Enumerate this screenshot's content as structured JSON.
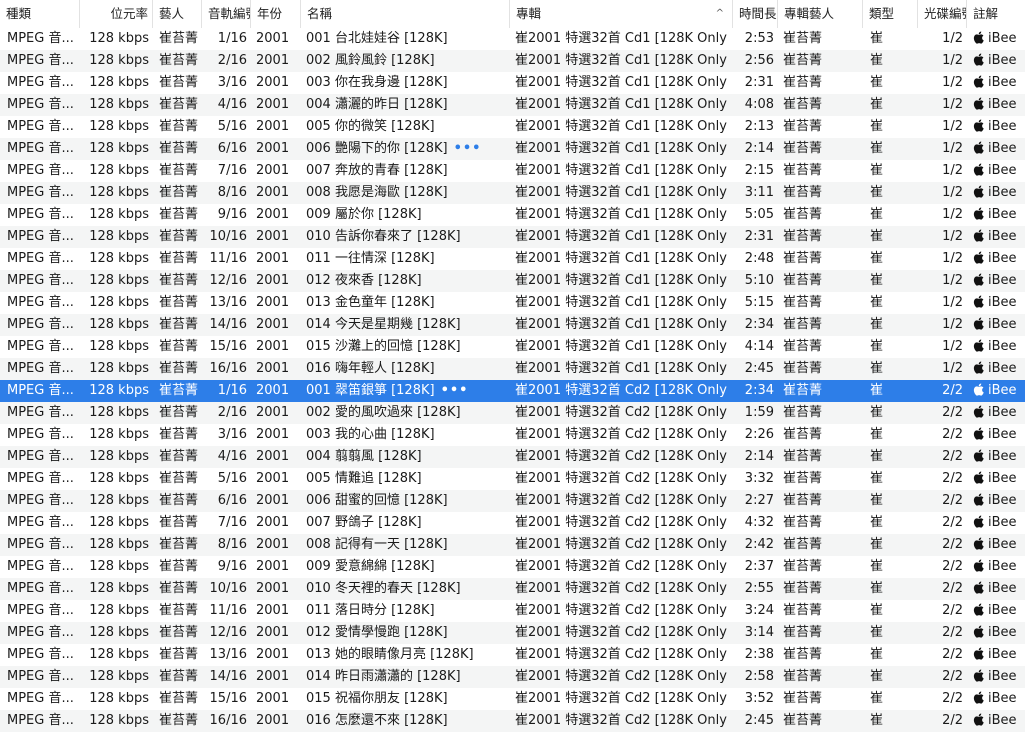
{
  "columns": {
    "kind": "種類",
    "bitrate": "位元率",
    "artist": "藝人",
    "track": "音軌編號",
    "year": "年份",
    "name": "名稱",
    "album": "專輯",
    "sort_indicator": "^",
    "time": "時間長度",
    "album_artist": "專輯藝人",
    "genre": "類型",
    "disc": "光碟編號",
    "comment": "註解"
  },
  "selected_row_index": 16,
  "rows": [
    {
      "kind": "MPEG 音...",
      "bitrate": "128 kbps",
      "artist": "崔苔菁",
      "track": "1/16",
      "year": "2001",
      "name": "001 台北娃娃谷 [128K]",
      "album": "崔2001 特選32首 Cd1 [128K Only]",
      "time": "2:53",
      "album_artist": "崔苔菁",
      "genre": "崔",
      "disc": "1/2",
      "comment": "iBee"
    },
    {
      "kind": "MPEG 音...",
      "bitrate": "128 kbps",
      "artist": "崔苔菁",
      "track": "2/16",
      "year": "2001",
      "name": "002 風鈴風鈴 [128K]",
      "album": "崔2001 特選32首 Cd1 [128K Only]",
      "time": "2:56",
      "album_artist": "崔苔菁",
      "genre": "崔",
      "disc": "1/2",
      "comment": "iBee"
    },
    {
      "kind": "MPEG 音...",
      "bitrate": "128 kbps",
      "artist": "崔苔菁",
      "track": "3/16",
      "year": "2001",
      "name": "003 你在我身邊 [128K]",
      "album": "崔2001 特選32首 Cd1 [128K Only]",
      "time": "2:31",
      "album_artist": "崔苔菁",
      "genre": "崔",
      "disc": "1/2",
      "comment": "iBee"
    },
    {
      "kind": "MPEG 音...",
      "bitrate": "128 kbps",
      "artist": "崔苔菁",
      "track": "4/16",
      "year": "2001",
      "name": "004 瀟灑的昨日 [128K]",
      "album": "崔2001 特選32首 Cd1 [128K Only]",
      "time": "4:08",
      "album_artist": "崔苔菁",
      "genre": "崔",
      "disc": "1/2",
      "comment": "iBee"
    },
    {
      "kind": "MPEG 音...",
      "bitrate": "128 kbps",
      "artist": "崔苔菁",
      "track": "5/16",
      "year": "2001",
      "name": "005 你的微笑 [128K]",
      "album": "崔2001 特選32首 Cd1 [128K Only]",
      "time": "2:13",
      "album_artist": "崔苔菁",
      "genre": "崔",
      "disc": "1/2",
      "comment": "iBee"
    },
    {
      "kind": "MPEG 音...",
      "bitrate": "128 kbps",
      "artist": "崔苔菁",
      "track": "6/16",
      "year": "2001",
      "name": "006 艷陽下的你 [128K]",
      "album": "崔2001 特選32首 Cd1 [128K Only]",
      "time": "2:14",
      "album_artist": "崔苔菁",
      "genre": "崔",
      "disc": "1/2",
      "comment": "iBee",
      "more": true
    },
    {
      "kind": "MPEG 音...",
      "bitrate": "128 kbps",
      "artist": "崔苔菁",
      "track": "7/16",
      "year": "2001",
      "name": "007 奔放的青春 [128K]",
      "album": "崔2001 特選32首 Cd1 [128K Only]",
      "time": "2:15",
      "album_artist": "崔苔菁",
      "genre": "崔",
      "disc": "1/2",
      "comment": "iBee"
    },
    {
      "kind": "MPEG 音...",
      "bitrate": "128 kbps",
      "artist": "崔苔菁",
      "track": "8/16",
      "year": "2001",
      "name": "008 我愿是海歐 [128K]",
      "album": "崔2001 特選32首 Cd1 [128K Only]",
      "time": "3:11",
      "album_artist": "崔苔菁",
      "genre": "崔",
      "disc": "1/2",
      "comment": "iBee"
    },
    {
      "kind": "MPEG 音...",
      "bitrate": "128 kbps",
      "artist": "崔苔菁",
      "track": "9/16",
      "year": "2001",
      "name": "009 屬於你 [128K]",
      "album": "崔2001 特選32首 Cd1 [128K Only]",
      "time": "5:05",
      "album_artist": "崔苔菁",
      "genre": "崔",
      "disc": "1/2",
      "comment": "iBee"
    },
    {
      "kind": "MPEG 音...",
      "bitrate": "128 kbps",
      "artist": "崔苔菁",
      "track": "10/16",
      "year": "2001",
      "name": "010 告訴你春來了 [128K]",
      "album": "崔2001 特選32首 Cd1 [128K Only]",
      "time": "2:31",
      "album_artist": "崔苔菁",
      "genre": "崔",
      "disc": "1/2",
      "comment": "iBee"
    },
    {
      "kind": "MPEG 音...",
      "bitrate": "128 kbps",
      "artist": "崔苔菁",
      "track": "11/16",
      "year": "2001",
      "name": "011 一往情深 [128K]",
      "album": "崔2001 特選32首 Cd1 [128K Only]",
      "time": "2:48",
      "album_artist": "崔苔菁",
      "genre": "崔",
      "disc": "1/2",
      "comment": "iBee"
    },
    {
      "kind": "MPEG 音...",
      "bitrate": "128 kbps",
      "artist": "崔苔菁",
      "track": "12/16",
      "year": "2001",
      "name": "012 夜來香 [128K]",
      "album": "崔2001 特選32首 Cd1 [128K Only]",
      "time": "5:10",
      "album_artist": "崔苔菁",
      "genre": "崔",
      "disc": "1/2",
      "comment": "iBee"
    },
    {
      "kind": "MPEG 音...",
      "bitrate": "128 kbps",
      "artist": "崔苔菁",
      "track": "13/16",
      "year": "2001",
      "name": "013 金色童年 [128K]",
      "album": "崔2001 特選32首 Cd1 [128K Only]",
      "time": "5:15",
      "album_artist": "崔苔菁",
      "genre": "崔",
      "disc": "1/2",
      "comment": "iBee"
    },
    {
      "kind": "MPEG 音...",
      "bitrate": "128 kbps",
      "artist": "崔苔菁",
      "track": "14/16",
      "year": "2001",
      "name": "014 今天是星期幾 [128K]",
      "album": "崔2001 特選32首 Cd1 [128K Only]",
      "time": "2:34",
      "album_artist": "崔苔菁",
      "genre": "崔",
      "disc": "1/2",
      "comment": "iBee"
    },
    {
      "kind": "MPEG 音...",
      "bitrate": "128 kbps",
      "artist": "崔苔菁",
      "track": "15/16",
      "year": "2001",
      "name": "015 沙灘上的回憶 [128K]",
      "album": "崔2001 特選32首 Cd1 [128K Only]",
      "time": "4:14",
      "album_artist": "崔苔菁",
      "genre": "崔",
      "disc": "1/2",
      "comment": "iBee"
    },
    {
      "kind": "MPEG 音...",
      "bitrate": "128 kbps",
      "artist": "崔苔菁",
      "track": "16/16",
      "year": "2001",
      "name": "016 嗨年輕人 [128K]",
      "album": "崔2001 特選32首 Cd1 [128K Only]",
      "time": "2:45",
      "album_artist": "崔苔菁",
      "genre": "崔",
      "disc": "1/2",
      "comment": "iBee"
    },
    {
      "kind": "MPEG 音...",
      "bitrate": "128 kbps",
      "artist": "崔苔菁",
      "track": "1/16",
      "year": "2001",
      "name": "001 翠笛銀箏 [128K]",
      "album": "崔2001 特選32首 Cd2 [128K Only]",
      "time": "2:34",
      "album_artist": "崔苔菁",
      "genre": "崔",
      "disc": "2/2",
      "comment": "iBee",
      "more": true
    },
    {
      "kind": "MPEG 音...",
      "bitrate": "128 kbps",
      "artist": "崔苔菁",
      "track": "2/16",
      "year": "2001",
      "name": "002 愛的風吹過來 [128K]",
      "album": "崔2001 特選32首 Cd2 [128K Only]",
      "time": "1:59",
      "album_artist": "崔苔菁",
      "genre": "崔",
      "disc": "2/2",
      "comment": "iBee"
    },
    {
      "kind": "MPEG 音...",
      "bitrate": "128 kbps",
      "artist": "崔苔菁",
      "track": "3/16",
      "year": "2001",
      "name": "003 我的心曲 [128K]",
      "album": "崔2001 特選32首 Cd2 [128K Only]",
      "time": "2:26",
      "album_artist": "崔苔菁",
      "genre": "崔",
      "disc": "2/2",
      "comment": "iBee"
    },
    {
      "kind": "MPEG 音...",
      "bitrate": "128 kbps",
      "artist": "崔苔菁",
      "track": "4/16",
      "year": "2001",
      "name": "004 翦翦風 [128K]",
      "album": "崔2001 特選32首 Cd2 [128K Only]",
      "time": "2:14",
      "album_artist": "崔苔菁",
      "genre": "崔",
      "disc": "2/2",
      "comment": "iBee"
    },
    {
      "kind": "MPEG 音...",
      "bitrate": "128 kbps",
      "artist": "崔苔菁",
      "track": "5/16",
      "year": "2001",
      "name": "005 情難追 [128K]",
      "album": "崔2001 特選32首 Cd2 [128K Only]",
      "time": "3:32",
      "album_artist": "崔苔菁",
      "genre": "崔",
      "disc": "2/2",
      "comment": "iBee"
    },
    {
      "kind": "MPEG 音...",
      "bitrate": "128 kbps",
      "artist": "崔苔菁",
      "track": "6/16",
      "year": "2001",
      "name": "006 甜蜜的回憶 [128K]",
      "album": "崔2001 特選32首 Cd2 [128K Only]",
      "time": "2:27",
      "album_artist": "崔苔菁",
      "genre": "崔",
      "disc": "2/2",
      "comment": "iBee"
    },
    {
      "kind": "MPEG 音...",
      "bitrate": "128 kbps",
      "artist": "崔苔菁",
      "track": "7/16",
      "year": "2001",
      "name": "007 野鴿子 [128K]",
      "album": "崔2001 特選32首 Cd2 [128K Only]",
      "time": "4:32",
      "album_artist": "崔苔菁",
      "genre": "崔",
      "disc": "2/2",
      "comment": "iBee"
    },
    {
      "kind": "MPEG 音...",
      "bitrate": "128 kbps",
      "artist": "崔苔菁",
      "track": "8/16",
      "year": "2001",
      "name": "008 記得有一天 [128K]",
      "album": "崔2001 特選32首 Cd2 [128K Only]",
      "time": "2:42",
      "album_artist": "崔苔菁",
      "genre": "崔",
      "disc": "2/2",
      "comment": "iBee"
    },
    {
      "kind": "MPEG 音...",
      "bitrate": "128 kbps",
      "artist": "崔苔菁",
      "track": "9/16",
      "year": "2001",
      "name": "009 愛意綿綿 [128K]",
      "album": "崔2001 特選32首 Cd2 [128K Only]",
      "time": "2:37",
      "album_artist": "崔苔菁",
      "genre": "崔",
      "disc": "2/2",
      "comment": "iBee"
    },
    {
      "kind": "MPEG 音...",
      "bitrate": "128 kbps",
      "artist": "崔苔菁",
      "track": "10/16",
      "year": "2001",
      "name": "010 冬天裡的春天 [128K]",
      "album": "崔2001 特選32首 Cd2 [128K Only]",
      "time": "2:55",
      "album_artist": "崔苔菁",
      "genre": "崔",
      "disc": "2/2",
      "comment": "iBee"
    },
    {
      "kind": "MPEG 音...",
      "bitrate": "128 kbps",
      "artist": "崔苔菁",
      "track": "11/16",
      "year": "2001",
      "name": "011 落日時分 [128K]",
      "album": "崔2001 特選32首 Cd2 [128K Only]",
      "time": "3:24",
      "album_artist": "崔苔菁",
      "genre": "崔",
      "disc": "2/2",
      "comment": "iBee"
    },
    {
      "kind": "MPEG 音...",
      "bitrate": "128 kbps",
      "artist": "崔苔菁",
      "track": "12/16",
      "year": "2001",
      "name": "012 愛情學慢跑 [128K]",
      "album": "崔2001 特選32首 Cd2 [128K Only]",
      "time": "3:14",
      "album_artist": "崔苔菁",
      "genre": "崔",
      "disc": "2/2",
      "comment": "iBee"
    },
    {
      "kind": "MPEG 音...",
      "bitrate": "128 kbps",
      "artist": "崔苔菁",
      "track": "13/16",
      "year": "2001",
      "name": "013 她的眼睛像月亮 [128K]",
      "album": "崔2001 特選32首 Cd2 [128K Only]",
      "time": "2:38",
      "album_artist": "崔苔菁",
      "genre": "崔",
      "disc": "2/2",
      "comment": "iBee"
    },
    {
      "kind": "MPEG 音...",
      "bitrate": "128 kbps",
      "artist": "崔苔菁",
      "track": "14/16",
      "year": "2001",
      "name": "014 昨日雨瀟瀟的 [128K]",
      "album": "崔2001 特選32首 Cd2 [128K Only]",
      "time": "2:58",
      "album_artist": "崔苔菁",
      "genre": "崔",
      "disc": "2/2",
      "comment": "iBee"
    },
    {
      "kind": "MPEG 音...",
      "bitrate": "128 kbps",
      "artist": "崔苔菁",
      "track": "15/16",
      "year": "2001",
      "name": "015 祝福你朋友 [128K]",
      "album": "崔2001 特選32首 Cd2 [128K Only]",
      "time": "3:52",
      "album_artist": "崔苔菁",
      "genre": "崔",
      "disc": "2/2",
      "comment": "iBee"
    },
    {
      "kind": "MPEG 音...",
      "bitrate": "128 kbps",
      "artist": "崔苔菁",
      "track": "16/16",
      "year": "2001",
      "name": "016 怎麼還不來 [128K]",
      "album": "崔2001 特選32首 Cd2 [128K Only]",
      "time": "2:45",
      "album_artist": "崔苔菁",
      "genre": "崔",
      "disc": "2/2",
      "comment": "iBee"
    }
  ],
  "colors": {
    "selection": "#2d7ee8",
    "row_stripe": "#f4f5f5",
    "header_border": "#d9d9d9"
  },
  "icons": {
    "comment_prefix": "apple-icon",
    "row_action": "more-icon"
  }
}
